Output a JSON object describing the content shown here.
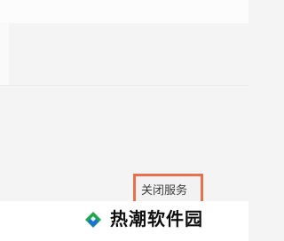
{
  "dialog": {
    "close_service_label": "关闭服务"
  },
  "watermark": {
    "logo_icon": "diamond-logo-icon",
    "text": "热潮软件园",
    "colors": {
      "green": "#1da84a",
      "blue": "#1a73d8"
    }
  },
  "colors": {
    "page_background": "#f4f4f4",
    "highlight_border": "#e8714d",
    "footer_background": "#ffffff"
  }
}
